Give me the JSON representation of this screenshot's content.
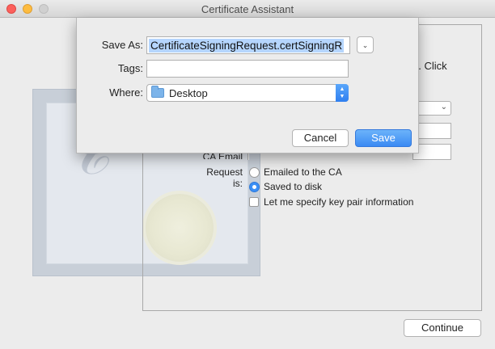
{
  "window": {
    "title": "Certificate Assistant",
    "continue_label": "Continue",
    "intro_fragment": "g. Click",
    "ca_email_label": "CA Email",
    "request_label": "Request is:",
    "request_options": [
      {
        "label": "Emailed to the CA",
        "selected": false
      },
      {
        "label": "Saved to disk",
        "selected": true
      }
    ],
    "keypair_label": "Let me specify key pair information",
    "keypair_checked": false
  },
  "save_sheet": {
    "save_as_label": "Save As:",
    "save_as_value": "CertificateSigningRequest.certSigningR",
    "tags_label": "Tags:",
    "tags_value": "",
    "where_label": "Where:",
    "where_value": "Desktop",
    "cancel_label": "Cancel",
    "save_label": "Save"
  },
  "colors": {
    "accent": "#3a8af3",
    "selection": "#b5d5fd",
    "close": "#fc605c",
    "minimize": "#fdbc40"
  },
  "icons": {
    "expand": "chevron-down-icon",
    "where_folder": "folder-icon",
    "where_stepper": "up-down-stepper-icon"
  }
}
